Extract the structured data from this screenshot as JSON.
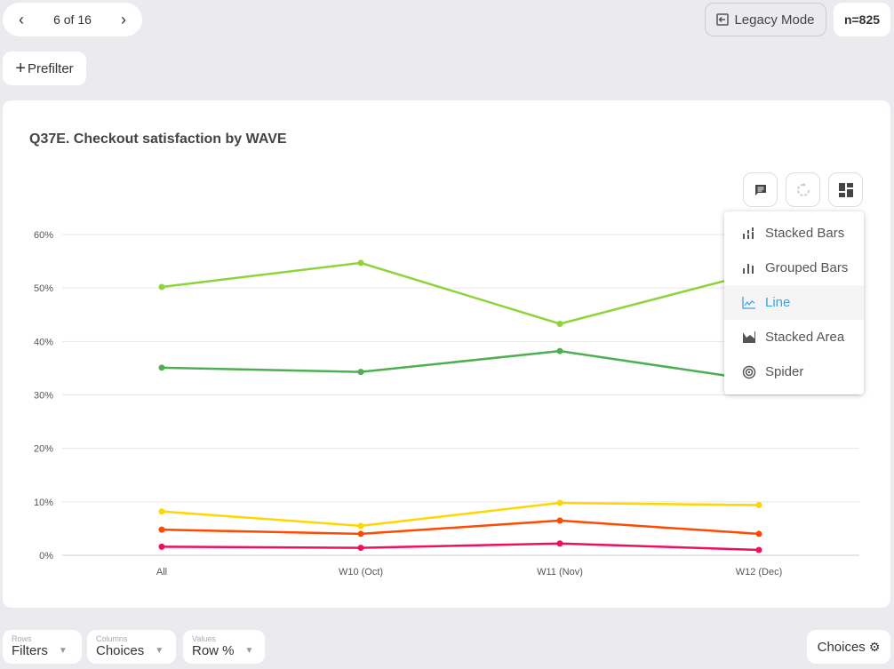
{
  "pager": {
    "label": "6 of 16",
    "prev_icon": "chevron-left-icon",
    "next_icon": "chevron-right-icon"
  },
  "legacy_label": "Legacy Mode",
  "n_label": "n=825",
  "prefilter_label": "Prefilter",
  "chart_title": "Q37E. Checkout satisfaction by WAVE",
  "menu": [
    {
      "label": "Stacked Bars",
      "icon": "stacked-bars-icon",
      "selected": false
    },
    {
      "label": "Grouped Bars",
      "icon": "grouped-bars-icon",
      "selected": false
    },
    {
      "label": "Line",
      "icon": "line-chart-icon",
      "selected": true
    },
    {
      "label": "Stacked Area",
      "icon": "area-chart-icon",
      "selected": false
    },
    {
      "label": "Spider",
      "icon": "spider-icon",
      "selected": false
    }
  ],
  "chart_data": {
    "type": "line",
    "categories": [
      "All",
      "W10 (Oct)",
      "W11 (Nov)",
      "W12 (Dec)"
    ],
    "ylim": [
      0,
      60
    ],
    "yticks": [
      "0%",
      "10%",
      "20%",
      "30%",
      "40%",
      "50%",
      "60%"
    ],
    "grid": true,
    "series": [
      {
        "color": "#8cd43a",
        "values": [
          50.2,
          54.7,
          43.3,
          53
        ]
      },
      {
        "color": "#4caf50",
        "values": [
          35.1,
          34.3,
          38.2,
          32.7
        ]
      },
      {
        "color": "#ffd600",
        "values": [
          8.2,
          5.5,
          9.8,
          9.4
        ]
      },
      {
        "color": "#ff4a00",
        "values": [
          4.8,
          4.0,
          6.5,
          4.0
        ]
      },
      {
        "color": "#f0105a",
        "values": [
          1.6,
          1.4,
          2.2,
          1.0
        ]
      }
    ]
  },
  "footer": {
    "rows": {
      "small": "Rows",
      "value": "Filters"
    },
    "columns": {
      "small": "Columns",
      "value": "Choices"
    },
    "values": {
      "small": "Values",
      "value": "Row %"
    },
    "choices_label": "Choices"
  }
}
